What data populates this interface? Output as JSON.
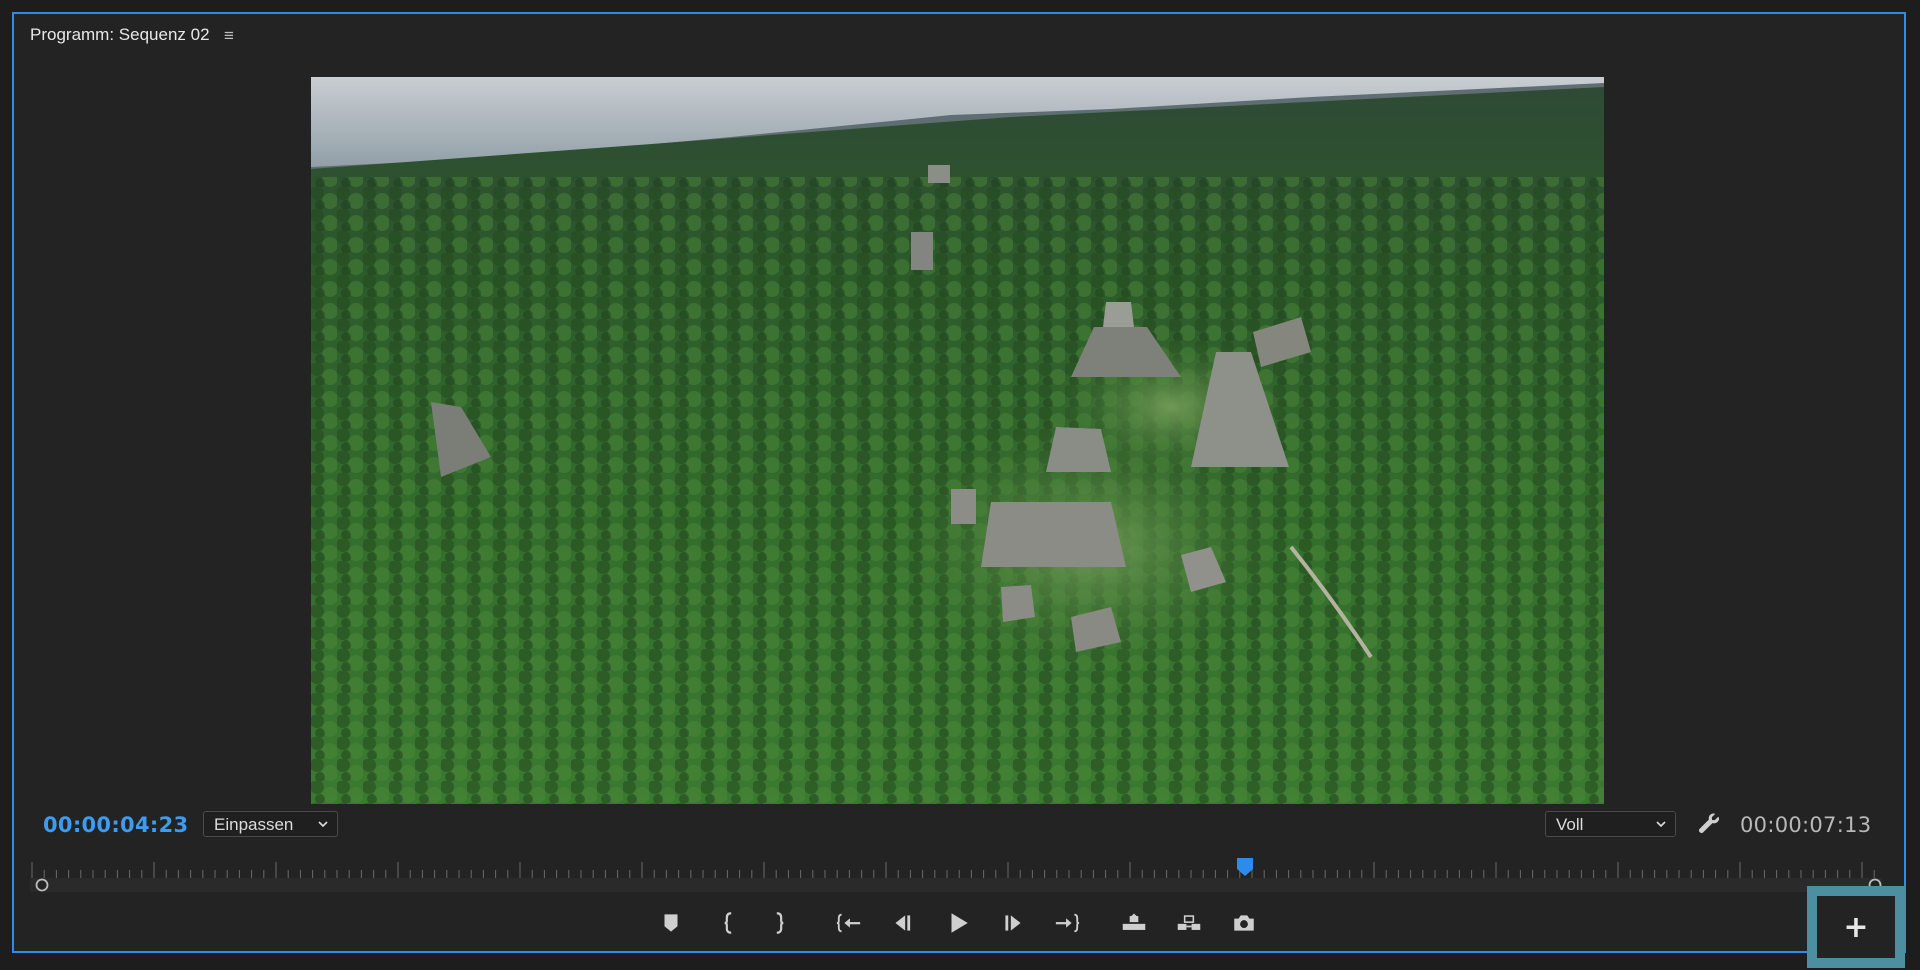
{
  "panel": {
    "title": "Programm: Sequenz 02",
    "menu_glyph": "≡",
    "accent_color": "#2d8ceb"
  },
  "monitor": {
    "current_timecode": "00:00:04:23",
    "duration_timecode": "00:00:07:13",
    "zoom_select": {
      "selected": "Einpassen"
    },
    "quality_select": {
      "selected": "Voll"
    },
    "settings_icon": "wrench-icon",
    "video_frame": "aerial-view-jungle-temple-ruins"
  },
  "timeline": {
    "playhead_color": "#2d8ceb"
  },
  "transport": {
    "buttons": [
      {
        "name": "add-marker-button",
        "icon": "marker-icon"
      },
      {
        "name": "mark-in-button",
        "icon": "mark-in-icon"
      },
      {
        "name": "mark-out-button",
        "icon": "mark-out-icon"
      },
      {
        "name": "go-to-in-button",
        "icon": "go-to-in-icon"
      },
      {
        "name": "step-back-button",
        "icon": "step-back-icon"
      },
      {
        "name": "play-button",
        "icon": "play-icon"
      },
      {
        "name": "step-forward-button",
        "icon": "step-forward-icon"
      },
      {
        "name": "go-to-out-button",
        "icon": "go-to-out-icon"
      },
      {
        "name": "lift-button",
        "icon": "lift-icon"
      },
      {
        "name": "extract-button",
        "icon": "extract-icon"
      },
      {
        "name": "export-frame-button",
        "icon": "camera-icon"
      }
    ],
    "button_editor": {
      "glyph": "+",
      "highlight_color": "#4d8fa0"
    }
  }
}
